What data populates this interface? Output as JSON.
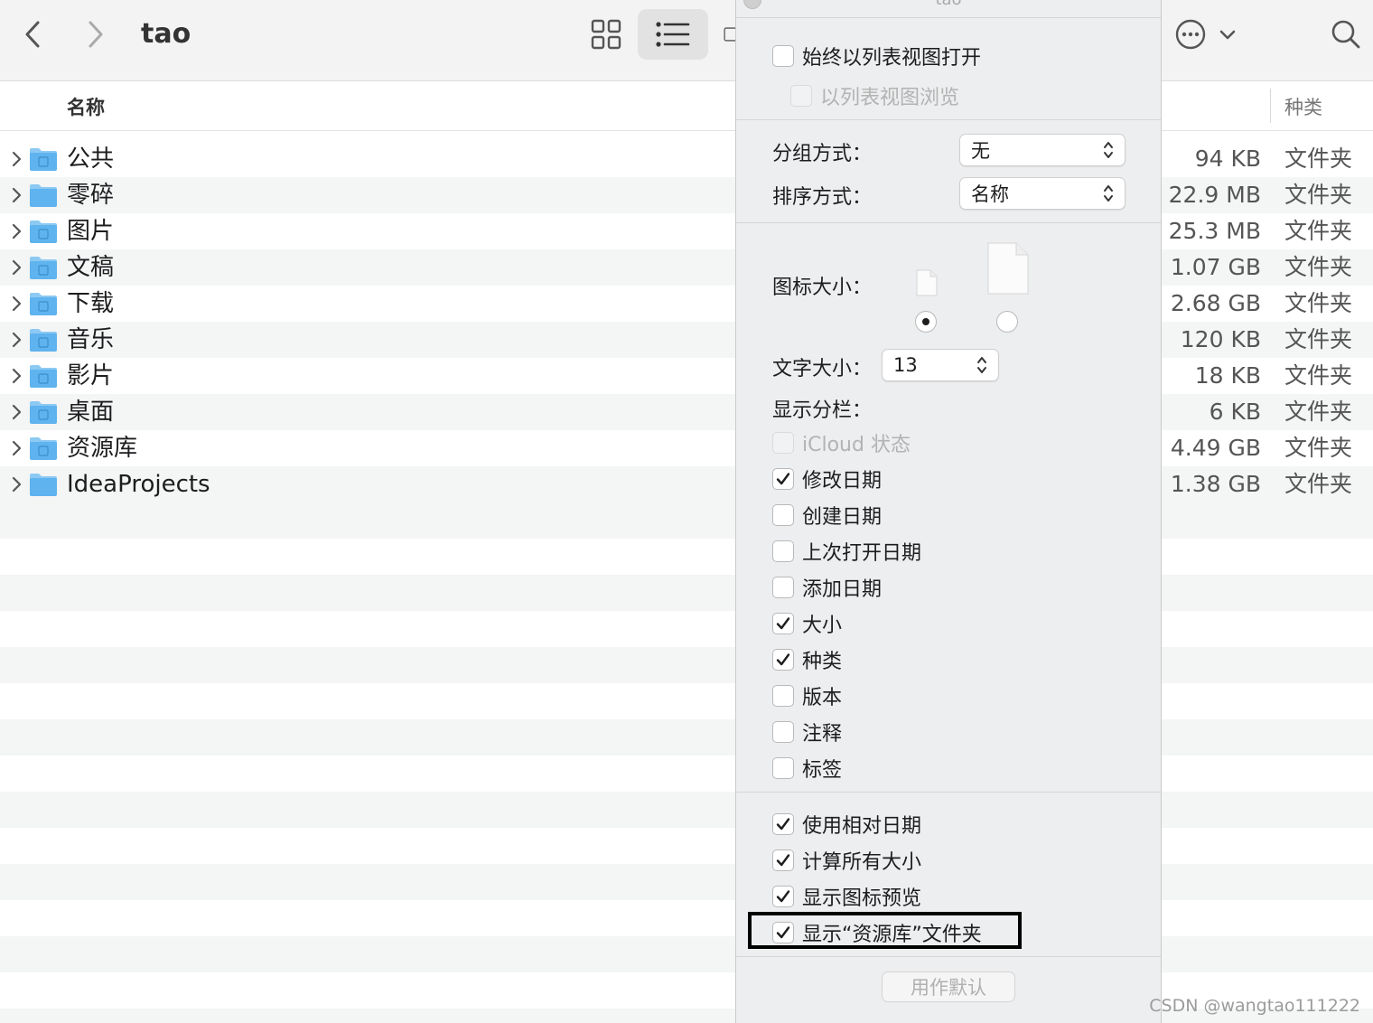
{
  "toolbar": {
    "title": "tao",
    "back_icon": "chevron-left-icon",
    "forward_icon": "chevron-right-icon",
    "views": [
      "icon-grid-view",
      "list-view",
      "column-view"
    ],
    "active_view": "list-view"
  },
  "columns": {
    "name": "名称",
    "kind": "种类"
  },
  "rows": [
    {
      "name": "公共",
      "size": "94 KB",
      "kind": "文件夹",
      "icon": "public-folder-icon"
    },
    {
      "name": "零碎",
      "size": "22.9 MB",
      "kind": "文件夹",
      "icon": "folder-icon"
    },
    {
      "name": "图片",
      "size": "25.3 MB",
      "kind": "文件夹",
      "icon": "pictures-folder-icon"
    },
    {
      "name": "文稿",
      "size": "1.07 GB",
      "kind": "文件夹",
      "icon": "documents-folder-icon"
    },
    {
      "name": "下载",
      "size": "2.68 GB",
      "kind": "文件夹",
      "icon": "downloads-folder-icon"
    },
    {
      "name": "音乐",
      "size": "120 KB",
      "kind": "文件夹",
      "icon": "music-folder-icon"
    },
    {
      "name": "影片",
      "size": "18 KB",
      "kind": "文件夹",
      "icon": "movies-folder-icon"
    },
    {
      "name": "桌面",
      "size": "6 KB",
      "kind": "文件夹",
      "icon": "desktop-folder-icon"
    },
    {
      "name": "资源库",
      "size": "4.49 GB",
      "kind": "文件夹",
      "icon": "library-folder-icon"
    },
    {
      "name": "IdeaProjects",
      "size": "1.38 GB",
      "kind": "文件夹",
      "icon": "folder-icon"
    }
  ],
  "panel": {
    "title": "tao",
    "always_open_list": {
      "label": "始终以列表视图打开",
      "checked": false
    },
    "browse_list": {
      "label": "以列表视图浏览",
      "checked": false,
      "disabled": true
    },
    "group_by": {
      "label": "分组方式：",
      "value": "无"
    },
    "sort_by": {
      "label": "排序方式：",
      "value": "名称"
    },
    "icon_size": {
      "label": "图标大小：",
      "selected": "small"
    },
    "text_size": {
      "label": "文字大小：",
      "value": "13"
    },
    "show_columns_label": "显示分栏：",
    "columns_options": [
      {
        "label": "iCloud 状态",
        "checked": false,
        "disabled": true
      },
      {
        "label": "修改日期",
        "checked": true
      },
      {
        "label": "创建日期",
        "checked": false
      },
      {
        "label": "上次打开日期",
        "checked": false
      },
      {
        "label": "添加日期",
        "checked": false
      },
      {
        "label": "大小",
        "checked": true
      },
      {
        "label": "种类",
        "checked": true
      },
      {
        "label": "版本",
        "checked": false
      },
      {
        "label": "注释",
        "checked": false
      },
      {
        "label": "标签",
        "checked": false
      }
    ],
    "bottom_options": [
      {
        "label": "使用相对日期",
        "checked": true
      },
      {
        "label": "计算所有大小",
        "checked": true
      },
      {
        "label": "显示图标预览",
        "checked": true
      },
      {
        "label": "显示“资源库”文件夹",
        "checked": true
      }
    ],
    "default_button": "用作默认"
  },
  "watermark": "CSDN @wangtao111222",
  "colors": {
    "folder": "#5fb3ee",
    "folder_tab": "#8cc9f3",
    "row_alt": "#f4f5f5",
    "panel_bg": "#eceeef"
  }
}
